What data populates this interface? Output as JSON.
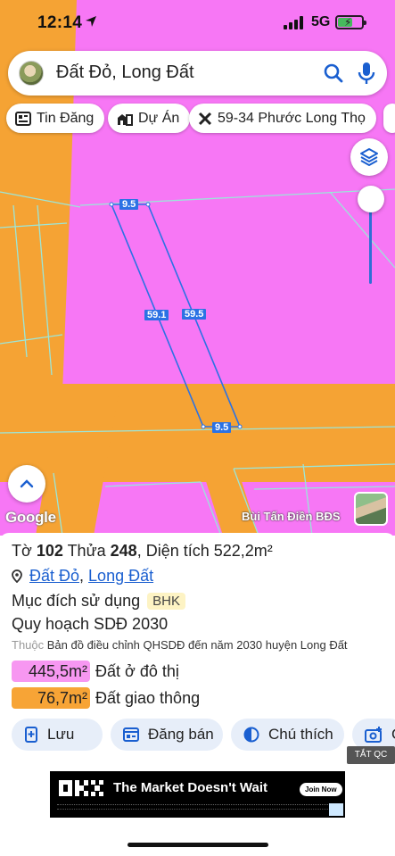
{
  "status_bar": {
    "time": "12:14",
    "network": "5G"
  },
  "search": {
    "query": "Đất Đỏ, Long Đất"
  },
  "chips": [
    {
      "label": "Tin Đăng",
      "icon": "news-icon"
    },
    {
      "label": "Dự Án",
      "icon": "building-icon"
    },
    {
      "label": "59-34 Phước Long Thọ",
      "icon": "tools-icon"
    }
  ],
  "map": {
    "colors": {
      "residential": "#f777f5",
      "road": "#f5a334",
      "parcel_line": "#2b72e4",
      "boundary": "#9be6d9"
    },
    "dimensions": {
      "top": "9.5",
      "bottom": "9.5",
      "left": "59.1",
      "right": "59.5"
    },
    "google_label": "Google",
    "credit": "Bùi Tấn Điền BĐS"
  },
  "parcel": {
    "sheet_label": "Tờ",
    "sheet_no": "102",
    "plot_label": "Thửa",
    "plot_no": "248",
    "area_text": ", Diện tích 522,2m²",
    "location": {
      "commune": "Đất Đỏ",
      "district": "Long Đất"
    },
    "purpose_label": "Mục đích sử dụng",
    "purpose_code": "BHK",
    "plan_title": "Quy hoạch SDĐ 2030",
    "belongs_prefix": "Thuộc",
    "belongs_text": "Bản đồ điều chỉnh QHSDĐ đến năm 2030 huyện Long Đất",
    "zones": [
      {
        "area": "445,5m²",
        "label": "Đất ở đô thị",
        "color": "#f797f1"
      },
      {
        "area": "76,7m²",
        "label": "Đất giao thông",
        "color": "#f7a436"
      }
    ]
  },
  "actions": [
    {
      "label": "Lưu",
      "icon": "bookmark-add-icon"
    },
    {
      "label": "Đăng bán",
      "icon": "listing-icon"
    },
    {
      "label": "Chú thích",
      "icon": "contrast-icon"
    },
    {
      "label": "C",
      "icon": "camera-add-icon"
    }
  ],
  "ad": {
    "tag": "TẮT QC",
    "brand": "OKX",
    "slogan": "The Market Doesn't Wait",
    "cta": "Join Now"
  }
}
